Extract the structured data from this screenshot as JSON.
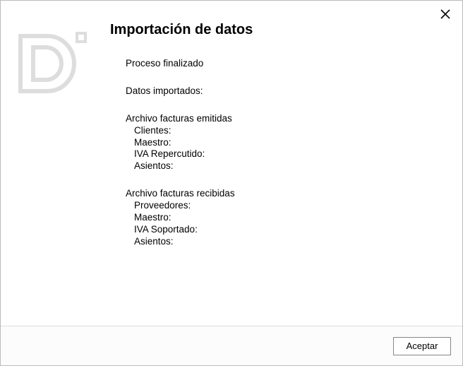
{
  "title": "Importación de datos",
  "process_finished": "Proceso finalizado",
  "data_imported_label": "Datos importados:",
  "emitted": {
    "heading": "Archivo facturas emitidas",
    "clientes_label": "Clientes:",
    "maestro_label": "Maestro:",
    "iva_label": "IVA Repercutido:",
    "asientos_label": "Asientos:"
  },
  "received": {
    "heading": "Archivo facturas recibidas",
    "proveedores_label": "Proveedores:",
    "maestro_label": "Maestro:",
    "iva_label": "IVA Soportado:",
    "asientos_label": "Asientos:"
  },
  "buttons": {
    "accept": "Aceptar"
  }
}
